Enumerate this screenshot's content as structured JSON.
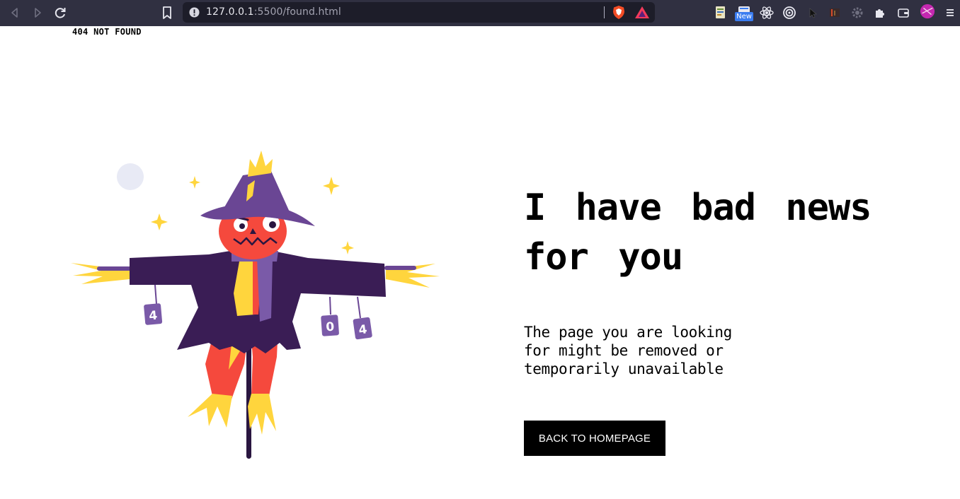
{
  "browser": {
    "url_host": "127.0.0.1",
    "url_path": ":5500/found.html",
    "extension_badge": "New",
    "colors": {
      "toolbar": "#303041",
      "urlbar": "#1d1d29"
    },
    "icons": [
      "back-icon",
      "forward-icon",
      "reload-icon",
      "bookmark-icon",
      "site-info-icon",
      "brave-shield-icon",
      "brave-rewards-icon",
      "extensions-icon",
      "wallet-icon",
      "profile-avatar",
      "menu-icon"
    ]
  },
  "page": {
    "top_label": "404 NOT FOUND",
    "headline": "I have bad news for you",
    "message": "The page you are looking for might be removed or temporarily unavailable",
    "button_label": "BACK TO HOMEPAGE",
    "illustration": {
      "subject": "scarecrow-illustration",
      "can_labels": [
        "4",
        "0",
        "4"
      ],
      "colors": {
        "coat": "#3a1d55",
        "hat": "#6a4694",
        "face": "#f5493d",
        "straw": "#ffd53d",
        "moon": "#e8eaf5"
      }
    }
  }
}
